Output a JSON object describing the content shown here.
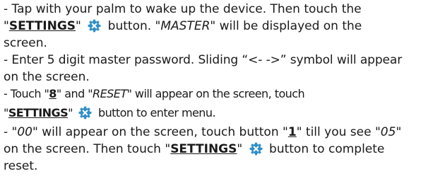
{
  "doc": {
    "l1": "- Tap with your palm to wake up the device. Then touch the",
    "l2a": "\"",
    "settings": "SETTINGS",
    "l2b": "\"",
    "l2c": " button.  \"",
    "master": "MASTER",
    "l2d": "\" will be displayed on the",
    "l3": "screen.",
    "l4": "- Enter 5 digit master password. Sliding “<- ->” symbol will appear",
    "l5": "on the screen.",
    "l6a": "- Touch \"",
    "eight": "8",
    "l6b": "\" and \"",
    "reset": "RESET",
    "l6c": "\" will appear on the screen, touch",
    "l7a": "\"",
    "l7b": "\"",
    "l7c": " button to enter menu.",
    "l8a": "- \"",
    "zz": "00",
    "l8b": "\" will appear on the screen, touch button \"",
    "one": "1",
    "l8c": "\" till you see \"",
    "o5": "05",
    "l8d": "\"",
    "l9a": "on the screen. Then touch \"",
    "l9b": "\"",
    "l9c": " button to complete",
    "l10": "reset."
  },
  "icons": {
    "settings_button": "gear-close-icon",
    "settings_button_color": "#2f8fc7"
  }
}
